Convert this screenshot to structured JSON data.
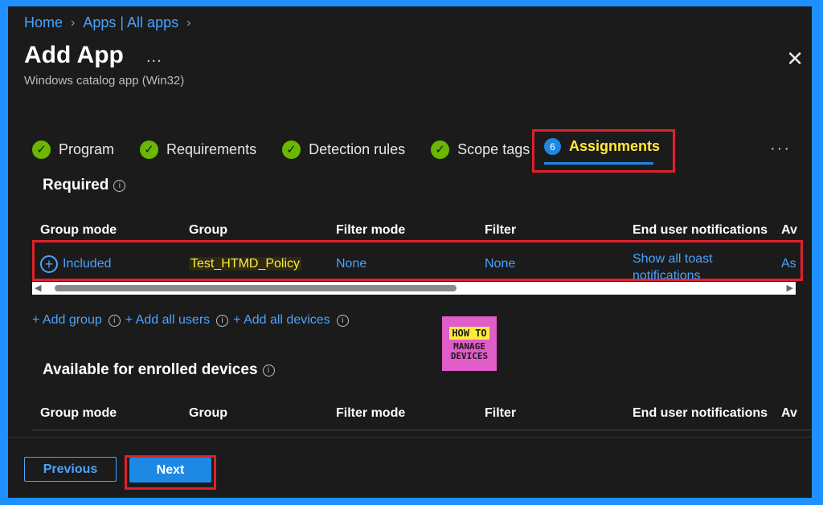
{
  "breadcrumb": {
    "home": "Home",
    "apps": "Apps | All apps"
  },
  "header": {
    "title": "Add App",
    "more": "...",
    "subtitle": "Windows catalog app (Win32)",
    "close": "✕"
  },
  "tabs": [
    {
      "label": "Program",
      "status": "complete"
    },
    {
      "label": "Requirements",
      "status": "complete"
    },
    {
      "label": "Detection rules",
      "status": "complete"
    },
    {
      "label": "Scope tags",
      "status": "complete"
    }
  ],
  "active_tab": {
    "number": "6",
    "label": "Assignments"
  },
  "tabs_more": "···",
  "required": {
    "title": "Required",
    "columns": [
      "Group mode",
      "Group",
      "Filter mode",
      "Filter",
      "End user notifications",
      "Av"
    ],
    "row": {
      "group_mode": "Included",
      "group": "Test_HTMD_Policy",
      "filter_mode": "None",
      "filter": "None",
      "notifications_line1": "Show all toast",
      "notifications_line2": "notifications",
      "availability": "As"
    }
  },
  "add_links": {
    "add_group": "+ Add group",
    "add_all_users": "+ Add all users",
    "add_all_devices": "+ Add all devices"
  },
  "logo": {
    "line1": "HOW TO",
    "line2": "MANAGE",
    "line3": "DEVICES"
  },
  "available": {
    "title": "Available for enrolled devices",
    "columns": [
      "Group mode",
      "Group",
      "Filter mode",
      "Filter",
      "End user notifications",
      "Av"
    ]
  },
  "footer": {
    "previous": "Previous",
    "next": "Next"
  },
  "colors": {
    "accent": "#1e88e5",
    "link": "#4aa3ff",
    "check": "#6bb700",
    "highlight": "#e0202a",
    "background": "#1b1b1b"
  }
}
